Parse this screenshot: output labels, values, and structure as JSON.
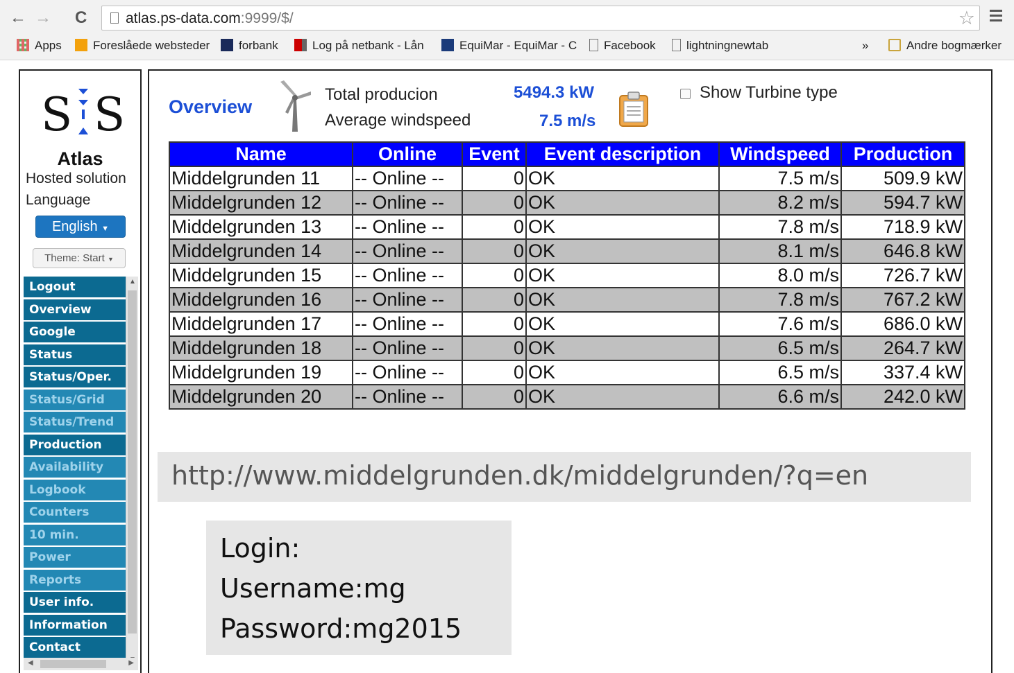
{
  "browser": {
    "url_host": "atlas.ps-data.com",
    "url_rest": ":9999/$/",
    "bookmarks": [
      "Apps",
      "Foreslåede websteder",
      "forbank",
      "Log på netbank - Lån",
      "EquiMar - EquiMar - C",
      "Facebook",
      "lightningnewtab",
      "»",
      "Andre bogmærker"
    ]
  },
  "sidebar": {
    "brand": "Atlas",
    "subtitle": "Hosted solution",
    "language_label": "Language",
    "language_value": "English",
    "theme_value": "Theme: Start",
    "menu": [
      {
        "label": "Logout",
        "dim": false
      },
      {
        "label": "Overview",
        "dim": false
      },
      {
        "label": "Google",
        "dim": false
      },
      {
        "label": "Status",
        "dim": false
      },
      {
        "label": "Status/Oper.",
        "dim": false
      },
      {
        "label": "Status/Grid",
        "dim": true
      },
      {
        "label": "Status/Trend",
        "dim": true
      },
      {
        "label": "Production",
        "dim": false
      },
      {
        "label": "Availability",
        "dim": true
      },
      {
        "label": "Logbook",
        "dim": true
      },
      {
        "label": "Counters",
        "dim": true
      },
      {
        "label": "10 min.",
        "dim": true
      },
      {
        "label": "Power",
        "dim": true
      },
      {
        "label": "Reports",
        "dim": true
      },
      {
        "label": "User info.",
        "dim": false
      },
      {
        "label": "Information",
        "dim": false
      },
      {
        "label": "Contact",
        "dim": false
      }
    ]
  },
  "overview": {
    "title": "Overview",
    "total_production_label": "Total producion",
    "total_production_value": "5494.3 kW",
    "average_windspeed_label": "Average windspeed",
    "average_windspeed_value": "7.5 m/s",
    "show_turbine_type_label": "Show Turbine type",
    "show_turbine_type_checked": false
  },
  "table": {
    "headers": [
      "Name",
      "Online",
      "Event",
      "Event description",
      "Windspeed",
      "Production"
    ],
    "rows": [
      [
        "Middelgrunden 11",
        "-- Online --",
        "0",
        "OK",
        "7.5 m/s",
        "509.9 kW"
      ],
      [
        "Middelgrunden 12",
        "-- Online --",
        "0",
        "OK",
        "8.2 m/s",
        "594.7 kW"
      ],
      [
        "Middelgrunden 13",
        "-- Online --",
        "0",
        "OK",
        "7.8 m/s",
        "718.9 kW"
      ],
      [
        "Middelgrunden 14",
        "-- Online --",
        "0",
        "OK",
        "8.1 m/s",
        "646.8 kW"
      ],
      [
        "Middelgrunden 15",
        "-- Online --",
        "0",
        "OK",
        "8.0 m/s",
        "726.7 kW"
      ],
      [
        "Middelgrunden 16",
        "-- Online --",
        "0",
        "OK",
        "7.8 m/s",
        "767.2 kW"
      ],
      [
        "Middelgrunden 17",
        "-- Online --",
        "0",
        "OK",
        "7.6 m/s",
        "686.0 kW"
      ],
      [
        "Middelgrunden 18",
        "-- Online --",
        "0",
        "OK",
        "6.5 m/s",
        "264.7 kW"
      ],
      [
        "Middelgrunden 19",
        "-- Online --",
        "0",
        "OK",
        "6.5 m/s",
        "337.4 kW"
      ],
      [
        "Middelgrunden 20",
        "-- Online --",
        "0",
        "OK",
        "6.6 m/s",
        "242.0 kW"
      ]
    ]
  },
  "annotation": {
    "url": "http://www.middelgrunden.dk/middelgrunden/?q=en",
    "login_lines": [
      "Login:",
      "Username:mg",
      "Password:mg2015"
    ]
  },
  "colors": {
    "accent_blue": "#1c4fd6",
    "table_header": "#0000ff",
    "row_alt": "#c0c0c0",
    "menu_active": "#0c6a91",
    "menu_dim": "#2388b4",
    "language_button": "#1d75c0"
  }
}
